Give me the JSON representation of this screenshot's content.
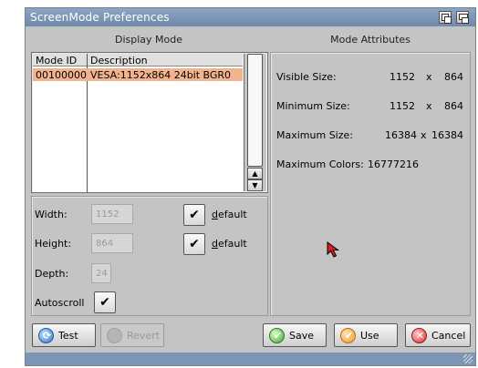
{
  "window": {
    "title": "ScreenMode Preferences"
  },
  "headers": {
    "display_mode": "Display Mode",
    "mode_attributes": "Mode Attributes"
  },
  "mode_list": {
    "columns": [
      "Mode ID",
      "Description"
    ],
    "rows": [
      {
        "id": "00100000",
        "description": "VESA:1152x864 24bit BGR0"
      }
    ]
  },
  "properties": {
    "width_label": "Width:",
    "width_value": "1152",
    "height_label": "Height:",
    "height_value": "864",
    "depth_label": "Depth:",
    "depth_value": "24",
    "autoscroll_label": "Autoscroll",
    "default_label": "default",
    "check_glyph": "✔"
  },
  "attributes": {
    "visible_label": "Visible Size:",
    "visible_w": "1152",
    "visible_x": "x",
    "visible_h": "864",
    "minimum_label": "Minimum Size:",
    "minimum_w": "1152",
    "minimum_x": "x",
    "minimum_h": "864",
    "maximum_label": "Maximum Size:",
    "maximum_w": "16384",
    "maximum_x": "x",
    "maximum_h": "16384",
    "colors_label": "Maximum Colors:",
    "colors_value": "16777216"
  },
  "buttons": {
    "test": "Test",
    "revert": "Revert",
    "save": "Save",
    "use": "Use",
    "cancel": "Cancel"
  },
  "colors": {
    "title_bar": "#7a93b3",
    "selected_row": "#f2b48e",
    "window_bg": "#c4c4c4"
  }
}
